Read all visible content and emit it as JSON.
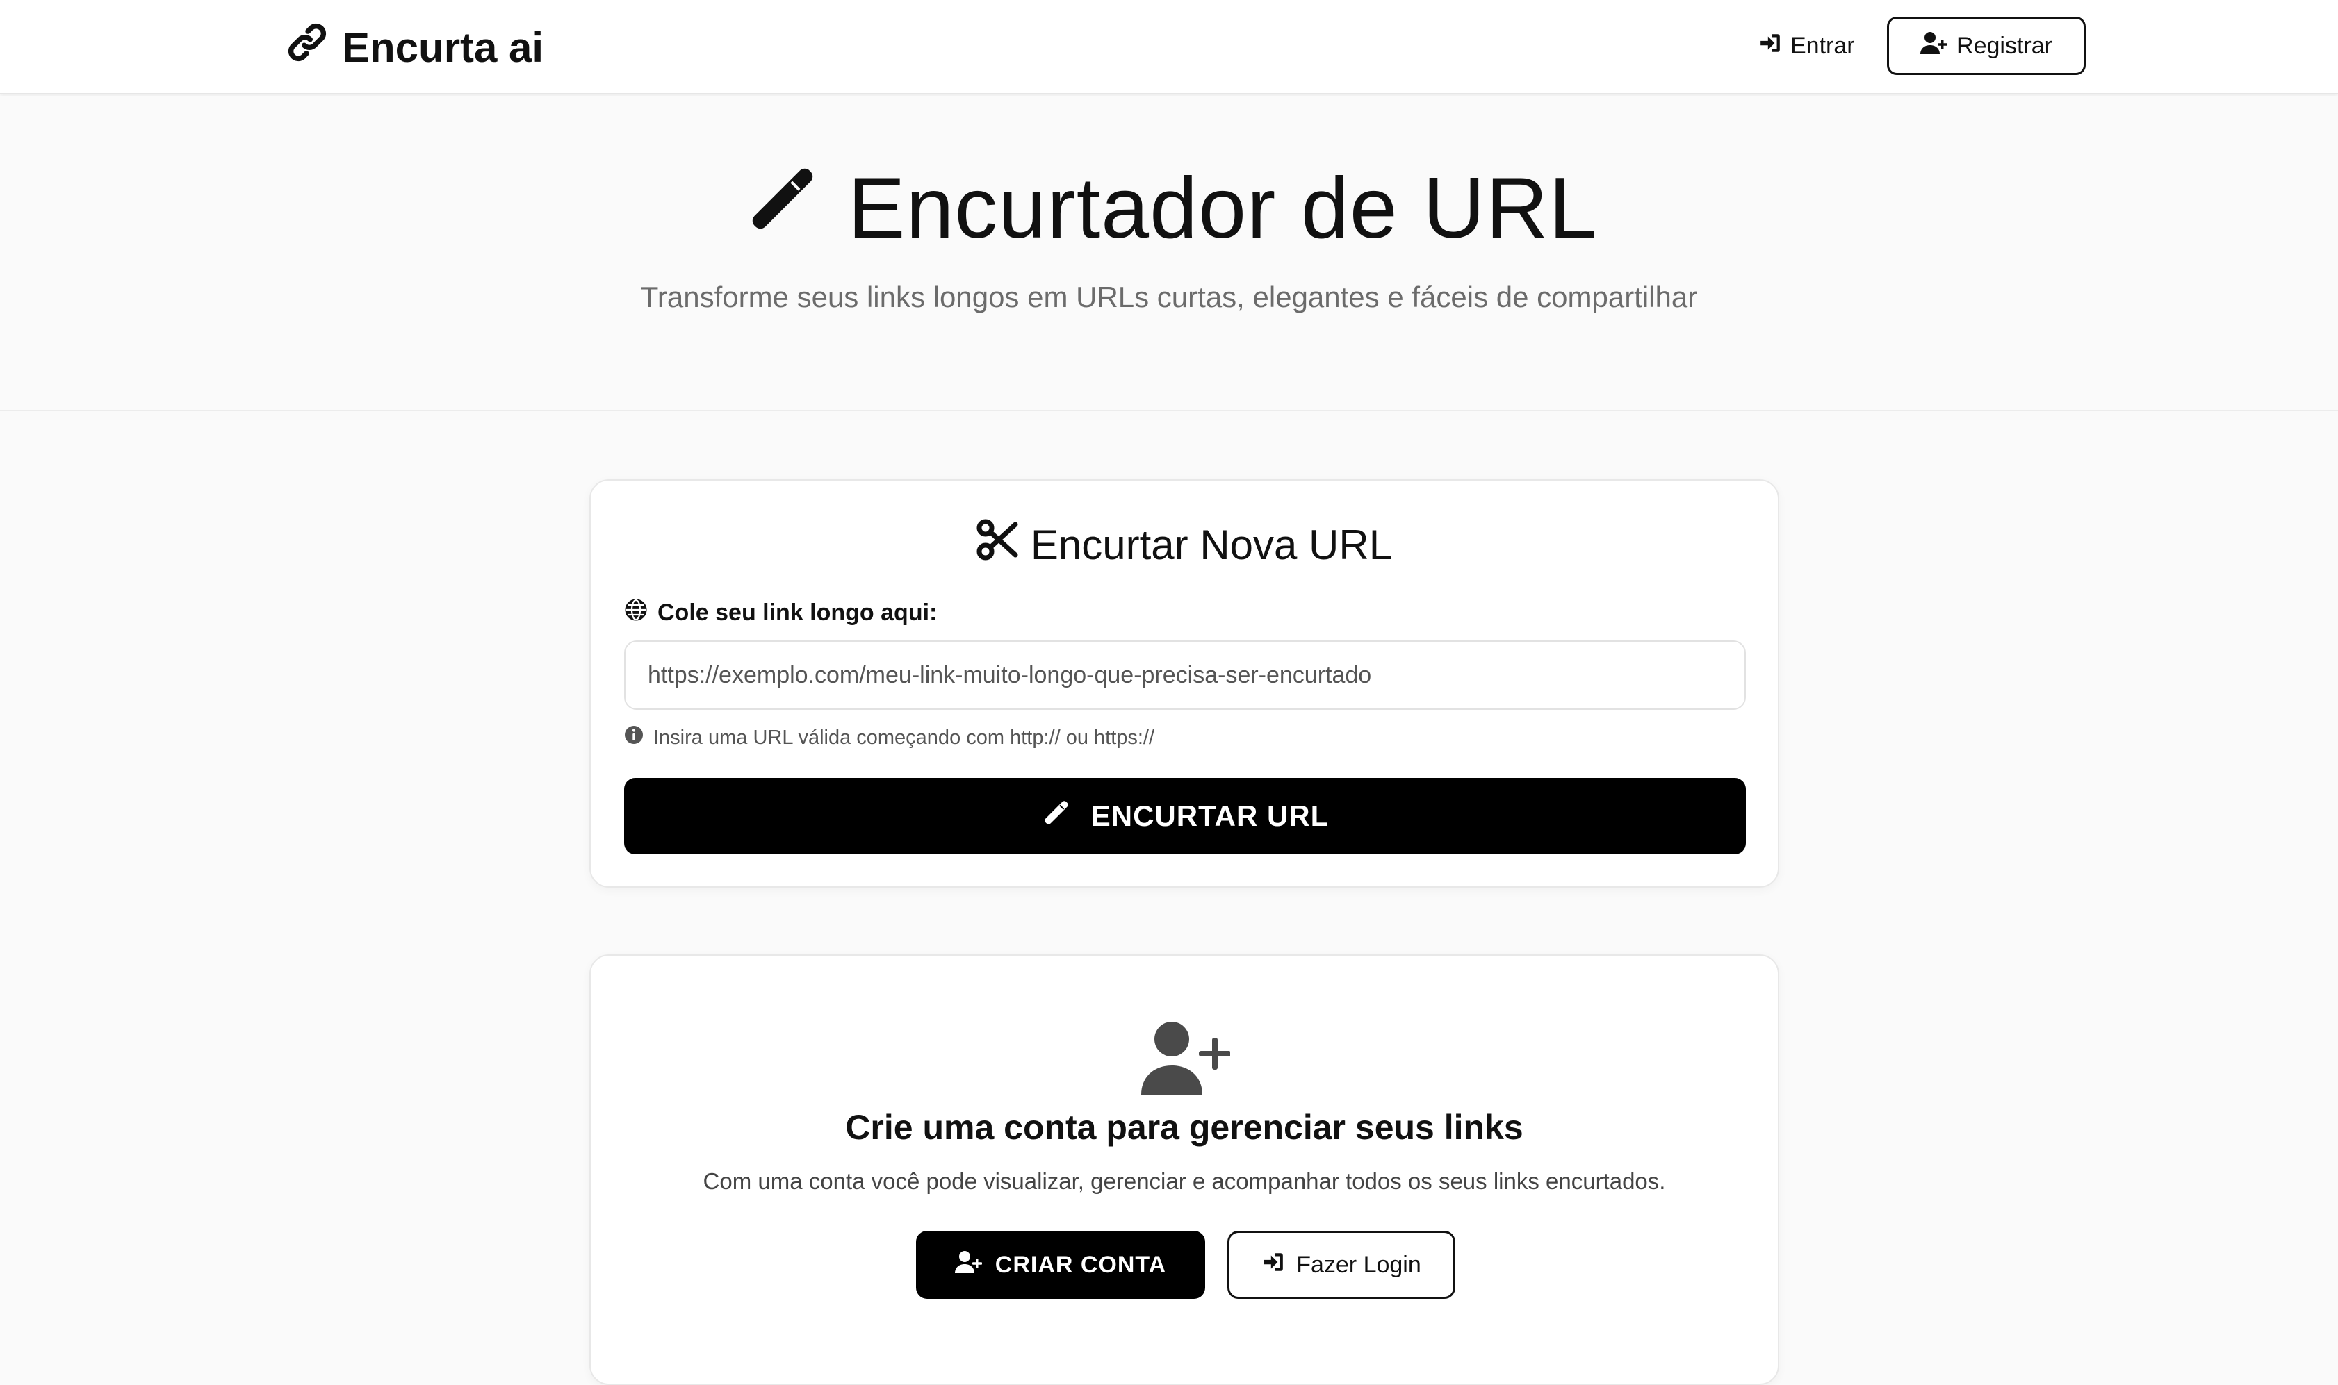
{
  "navbar": {
    "brand": "Encurta ai",
    "brand_icon": "link-icon",
    "login_label": "Entrar",
    "register_label": "Registrar"
  },
  "hero": {
    "title": "Encurtador de URL",
    "title_icon": "magic-wand-icon",
    "subtitle": "Transforme seus links longos em URLs curtas, elegantes e fáceis de compartilhar"
  },
  "shorten_card": {
    "title": "Encurtar Nova URL",
    "title_icon": "scissors-icon",
    "field_label": "Cole seu link longo aqui:",
    "input_placeholder": "https://exemplo.com/meu-link-muito-longo-que-precisa-ser-encurtado",
    "input_value": "",
    "hint": "Insira uma URL válida começando com http:// ou https://",
    "submit_label": "ENCURTAR URL"
  },
  "account_card": {
    "icon": "user-plus-icon",
    "title": "Crie uma conta para gerenciar seus links",
    "description": "Com uma conta você pode visualizar, gerenciar e acompanhar todos os seus links encurtados.",
    "create_label": "CRIAR CONTA",
    "login_label": "Fazer Login"
  },
  "colors": {
    "primary": "#000000",
    "background": "#fafafa",
    "muted_text": "#6b6b6b",
    "card_border": "#e8e8e8"
  }
}
